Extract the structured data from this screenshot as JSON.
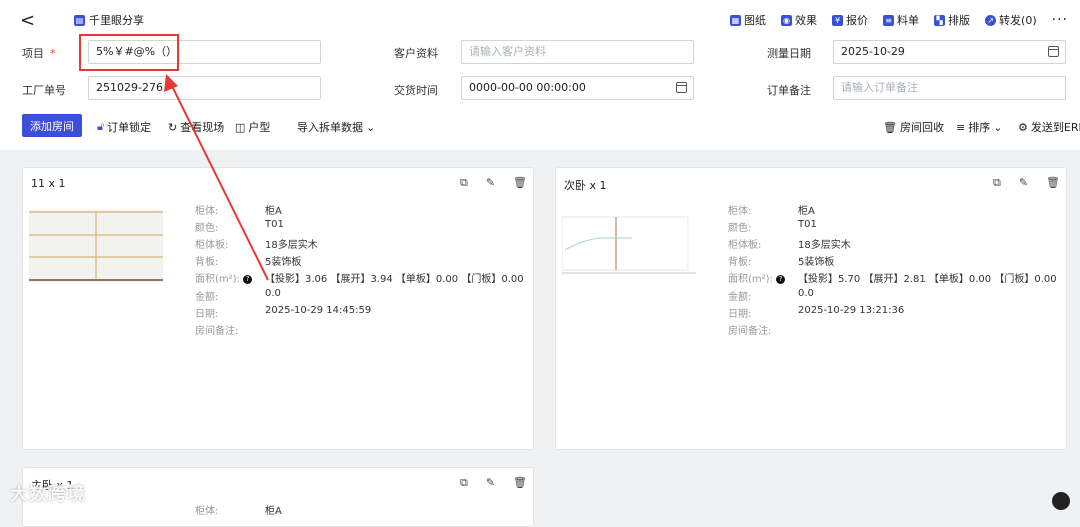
{
  "header": {
    "back_label": "<",
    "title": "千里眼分享",
    "toolbar": [
      {
        "name": "drawing",
        "label": "图纸"
      },
      {
        "name": "effect",
        "label": "效果"
      },
      {
        "name": "quote",
        "label": "报价"
      },
      {
        "name": "materials",
        "label": "料单"
      },
      {
        "name": "layout",
        "label": "排版"
      },
      {
        "name": "forward",
        "label": "转发(0)"
      }
    ],
    "more": "···"
  },
  "form": {
    "project_label": "项目",
    "project_required": "*",
    "project_value": "5%￥#@%（）",
    "customer_label": "客户资料",
    "customer_placeholder": "请输入客户资料",
    "measure_date_label": "测量日期",
    "measure_date_value": "2025-10-29",
    "factory_no_label": "工厂单号",
    "factory_no_value": "251029-276",
    "delivery_label": "交货时间",
    "delivery_value": "0000-00-00 00:00:00",
    "order_note_label": "订单备注",
    "order_note_placeholder": "请输入订单备注"
  },
  "actions": {
    "add_room": "添加房间",
    "lock_order": "订单锁定",
    "view_site": "查看现场",
    "floor_plan": "户型",
    "import_split": "导入拆单数据",
    "recycle": "房间回收",
    "sort": "排序",
    "send_erp": "发送到ERP"
  },
  "field_labels": {
    "cabinet": "柜体:",
    "color": "颜色:",
    "cabinet_board": "柜体板:",
    "back_board": "背板:",
    "area": "面积(m²):",
    "amount": "金额:",
    "date": "日期:",
    "room_note": "房间备注:"
  },
  "cards": [
    {
      "title": "11 x 1",
      "cabinet": "柜A",
      "color": "T01",
      "cabinet_board": "18多层实木",
      "back_board": "5装饰板",
      "area": "【投影】3.06 【展开】3.94 【单板】0.00 【门板】0.00",
      "amount": "0.0",
      "date": "2025-10-29 14:45:59",
      "room_note": ""
    },
    {
      "title": "次卧 x 1",
      "cabinet": "柜A",
      "color": "T01",
      "cabinet_board": "18多层实木",
      "back_board": "5装饰板",
      "area": "【投影】5.70 【展开】2.81 【单板】0.00 【门板】0.00",
      "amount": "0.0",
      "date": "2025-10-29 13:21:36",
      "room_note": ""
    },
    {
      "title": "主卧 x 1",
      "cabinet": "柜A"
    }
  ],
  "watermark": "大数跨境",
  "colors": {
    "primary": "#3b4fd8",
    "annotation": "#e53935"
  }
}
